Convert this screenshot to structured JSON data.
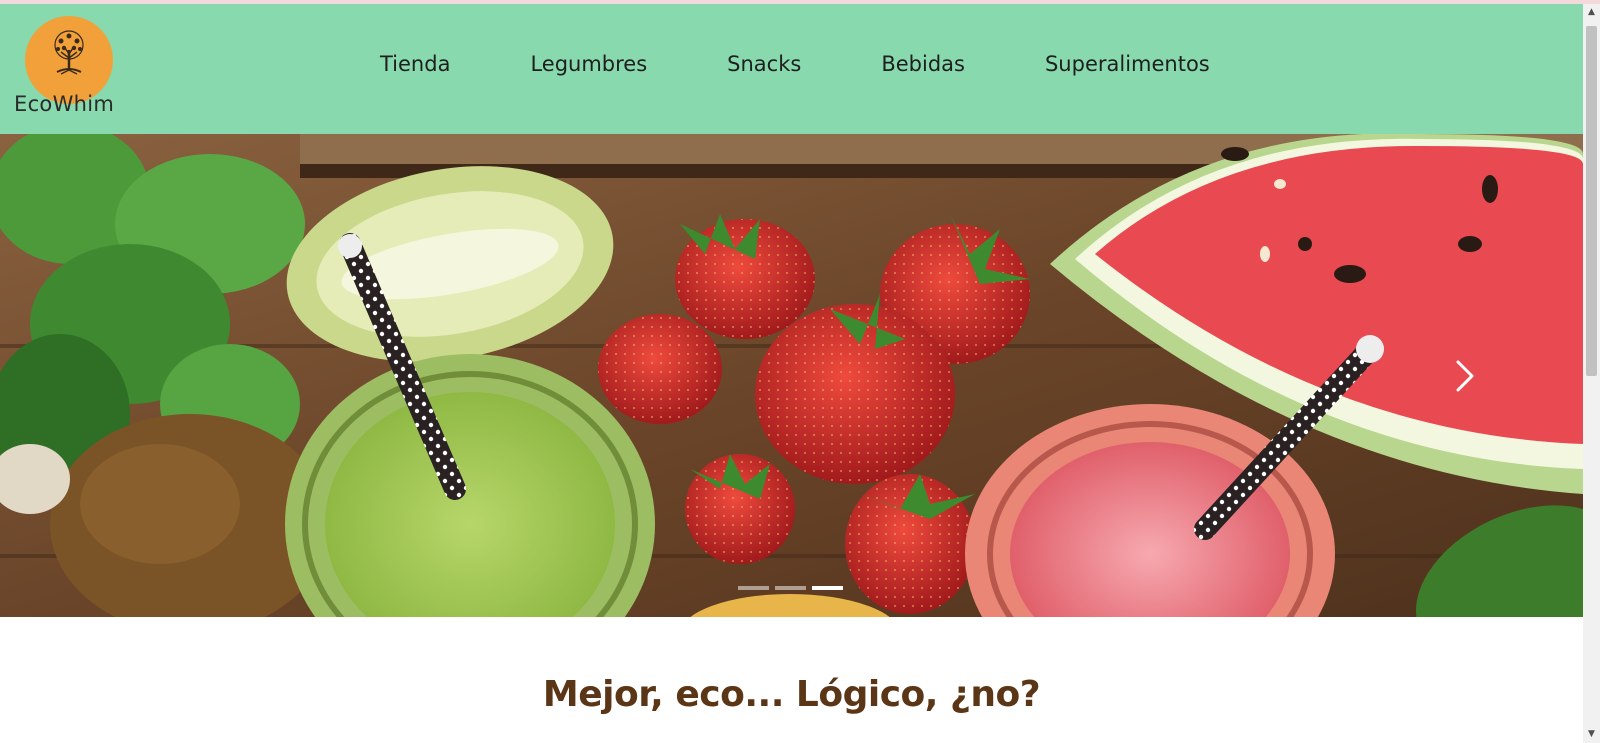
{
  "brand": {
    "name": "EcoWhim",
    "logo_icon": "tree-icon",
    "color_header": "#88d9ad",
    "color_logo": "#f2a03a"
  },
  "nav": {
    "items": [
      {
        "label": "Tienda"
      },
      {
        "label": "Legumbres"
      },
      {
        "label": "Snacks"
      },
      {
        "label": "Bebidas"
      },
      {
        "label": "Superalimentos"
      }
    ]
  },
  "carousel": {
    "next_icon": "chevron-right-icon",
    "slides": 3,
    "active_index": 2,
    "image_description_icon": "fruit-smoothies-photo"
  },
  "main": {
    "tagline": "Mejor, eco... Lógico, ¿no?",
    "tagline_color": "#5a3516"
  }
}
